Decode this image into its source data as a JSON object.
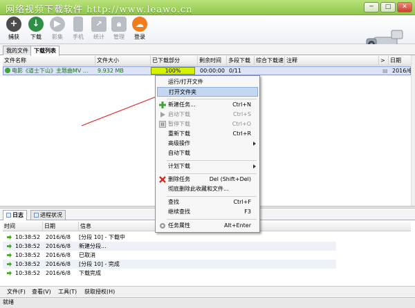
{
  "app": {
    "title": "网络视频下载软件    http://www.leawo.cn"
  },
  "window_buttons": [
    "─",
    "□",
    "✕"
  ],
  "toolbar": {
    "items": [
      {
        "label": "捕获",
        "icon": "plus-icon",
        "color": "#4c4c4c",
        "enabled": true
      },
      {
        "label": "下载",
        "icon": "download-icon",
        "color": "#2f8f46",
        "enabled": true
      },
      {
        "label": "影集",
        "icon": "play-icon",
        "color": "#b9bec5",
        "enabled": false
      },
      {
        "label": "手机",
        "icon": "phone-icon",
        "color": "#b9bec5",
        "enabled": false
      },
      {
        "label": "统计",
        "icon": "chart-icon",
        "color": "#b9bec5",
        "enabled": false
      },
      {
        "label": "管理",
        "icon": "lock-icon",
        "color": "#b9bec5",
        "enabled": false
      },
      {
        "label": "登录",
        "icon": "cloud-icon",
        "color": "#f07c1e",
        "enabled": true
      }
    ]
  },
  "tabs_top": [
    {
      "label": "我的文件",
      "active": false
    },
    {
      "label": "下载列表",
      "active": true
    }
  ],
  "list": {
    "columns": [
      "文件名称",
      "文件大小",
      "已下载部分",
      "剩余时间",
      "多段下载",
      "综合下载速",
      "注释",
      ">",
      "日期"
    ],
    "rows": [
      {
        "name": "电影《道士下山》主题曲MV ...",
        "size": "9.932 MB",
        "progress_text": "100%",
        "progress": 1.0,
        "remaining": "00:00:00",
        "segments": "0/11",
        "speed": "",
        "note": "",
        "date": "2016/6/"
      }
    ]
  },
  "context_menu": {
    "items": [
      {
        "label": "运行/打开文件",
        "shortcut": "",
        "enabled": true,
        "icon": ""
      },
      {
        "label": "打开文件夹",
        "shortcut": "",
        "enabled": true,
        "highlighted": true,
        "icon": ""
      },
      {
        "separator": true
      },
      {
        "label": "新建任务...",
        "shortcut": "Ctrl+N",
        "enabled": true,
        "icon": "add-icon"
      },
      {
        "label": "启动下载",
        "shortcut": "Ctrl+S",
        "enabled": false,
        "icon": "play-icon"
      },
      {
        "label": "暂停下载",
        "shortcut": "Ctrl+O",
        "enabled": false,
        "icon": "pause-icon"
      },
      {
        "label": "重新下载",
        "shortcut": "Ctrl+R",
        "enabled": true,
        "icon": ""
      },
      {
        "label": "高级操作",
        "shortcut": "",
        "enabled": true,
        "submenu": true,
        "icon": ""
      },
      {
        "label": "自动下载",
        "shortcut": "",
        "enabled": true,
        "icon": ""
      },
      {
        "separator": true
      },
      {
        "label": "计划下载",
        "shortcut": "",
        "enabled": true,
        "submenu": true,
        "icon": ""
      },
      {
        "separator": true
      },
      {
        "label": "删除任务",
        "shortcut": "Del (Shift+Del)",
        "enabled": true,
        "icon": "delete-icon"
      },
      {
        "label": "彻底删除此收藏和文件...",
        "shortcut": "",
        "enabled": true,
        "icon": ""
      },
      {
        "separator": true
      },
      {
        "label": "查找",
        "shortcut": "Ctrl+F",
        "enabled": true,
        "icon": ""
      },
      {
        "label": "继续查找",
        "shortcut": "F3",
        "enabled": true,
        "icon": ""
      },
      {
        "separator": true
      },
      {
        "label": "任务属性",
        "shortcut": "Alt+Enter",
        "enabled": true,
        "icon": "gear-icon"
      }
    ]
  },
  "tabs_bottom": [
    {
      "label": "日志",
      "active": true
    },
    {
      "label": "进程状况",
      "active": false
    }
  ],
  "log": {
    "columns": [
      "时间",
      "日期",
      "信息"
    ],
    "rows": [
      {
        "time": "10:38:52",
        "date": "2016/6/8",
        "info": "[分段 10] - 下载中"
      },
      {
        "time": "10:38:52",
        "date": "2016/6/8",
        "info": "新建分段..."
      },
      {
        "time": "10:38:52",
        "date": "2016/6/8",
        "info": "已取消"
      },
      {
        "time": "10:38:52",
        "date": "2016/6/8",
        "info": "[分段 10] - 完成"
      },
      {
        "time": "10:38:52",
        "date": "2016/6/8",
        "info": "下载完成"
      }
    ]
  },
  "menubar": [
    "文件(F)",
    "查看(V)",
    "工具(T)",
    "获取授权(H)"
  ],
  "status": {
    "text": "就绪"
  },
  "colors": {
    "title_green": "#8fc64b",
    "progress_yellow": "#d7f200",
    "arrow_red": "#e0242a",
    "highlight_blue": "#c5d6f0"
  }
}
